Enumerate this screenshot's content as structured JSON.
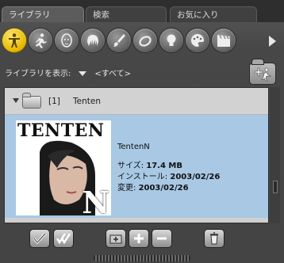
{
  "tabs": [
    {
      "label": "ライブラリ",
      "active": true
    },
    {
      "label": "検索",
      "active": false
    },
    {
      "label": "お気に入り",
      "active": false
    }
  ],
  "categories": [
    {
      "icon": "human-figure-icon",
      "active": true
    },
    {
      "icon": "running-figure-icon",
      "active": false
    },
    {
      "icon": "face-icon",
      "active": false
    },
    {
      "icon": "hair-icon",
      "active": false
    },
    {
      "icon": "brush-icon",
      "active": false
    },
    {
      "icon": "ring-icon",
      "active": false
    },
    {
      "icon": "light-bulb-icon",
      "active": false
    },
    {
      "icon": "palette-icon",
      "active": false
    },
    {
      "icon": "clapperboard-icon",
      "active": false
    }
  ],
  "show_library": {
    "label": "ライブラリを表示:",
    "value": "<すべて>"
  },
  "library": {
    "count": "[1]",
    "name": "Tenten"
  },
  "item": {
    "thumb_title": "TENTEN",
    "thumb_letter": "N",
    "name": "TentenN",
    "size_label": "サイズ: ",
    "size_value": "17.4 MB",
    "install_label": "インストール: ",
    "install_value": "2003/02/26",
    "changed_label": "変更: ",
    "changed_value": "2003/02/26"
  },
  "colors": {
    "accent": "#e6b800",
    "selection": "#a8c8e4"
  }
}
